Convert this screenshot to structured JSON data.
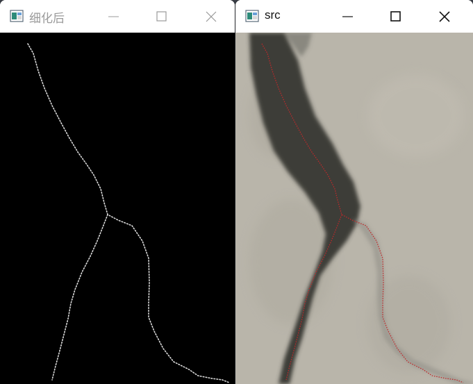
{
  "windows": [
    {
      "title": "细化后",
      "state": "inactive",
      "controls": {
        "minimize": "minimize-icon",
        "maximize": "maximize-icon",
        "close": "close-icon"
      }
    },
    {
      "title": "src",
      "state": "active",
      "controls": {
        "minimize": "minimize-icon",
        "maximize": "maximize-icon",
        "close": "close-icon"
      }
    }
  ],
  "colors": {
    "skeleton_background": "#000000",
    "skeleton_line": "#d8d8d8",
    "crack_overlay": "#c0282a",
    "concrete": "#b8b4a9",
    "crack_dark": "#3b3b36"
  }
}
